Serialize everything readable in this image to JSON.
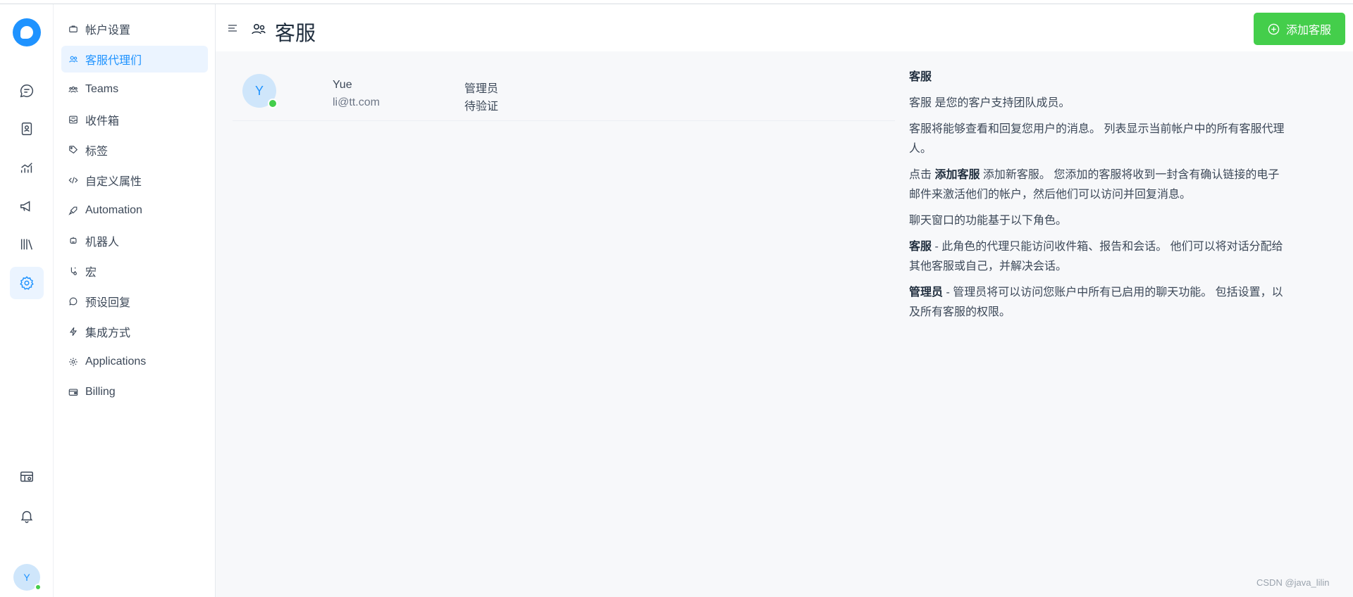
{
  "sidebar": {
    "items": [
      {
        "label": "帐户设置",
        "icon": "briefcase-icon"
      },
      {
        "label": "客服代理们",
        "icon": "people-icon",
        "active": true
      },
      {
        "label": "Teams",
        "icon": "teams-icon"
      },
      {
        "label": "收件箱",
        "icon": "inbox-icon"
      },
      {
        "label": "标签",
        "icon": "tag-icon"
      },
      {
        "label": "自定义属性",
        "icon": "code-icon"
      },
      {
        "label": "Automation",
        "icon": "rocket-icon"
      },
      {
        "label": "机器人",
        "icon": "bot-icon"
      },
      {
        "label": "宏",
        "icon": "macro-icon"
      },
      {
        "label": "预设回复",
        "icon": "chat-bubble-icon"
      },
      {
        "label": "集成方式",
        "icon": "flash-icon"
      },
      {
        "label": "Applications",
        "icon": "apps-icon"
      },
      {
        "label": "Billing",
        "icon": "wallet-icon"
      }
    ]
  },
  "rail": {
    "avatar_initial": "Y",
    "icons": [
      "conversations-icon",
      "contacts-icon",
      "reports-icon",
      "campaigns-icon",
      "library-icon",
      "settings-icon",
      "portal-icon",
      "bell-icon"
    ]
  },
  "header": {
    "title": "客服",
    "add_button_label": "添加客服"
  },
  "agents": [
    {
      "initial": "Y",
      "name": "Yue",
      "email": "li@tt.com",
      "role": "管理员",
      "status": "待验证"
    }
  ],
  "help": {
    "title": "客服",
    "p1": "客服 是您的客户支持团队成员。",
    "p2": "客服将能够查看和回复您用户的消息。 列表显示当前帐户中的所有客服代理人。",
    "p3_prefix": "点击 ",
    "p3_bold": "添加客服",
    "p3_suffix": " 添加新客服。 您添加的客服将收到一封含有确认链接的电子邮件来激活他们的帐户，然后他们可以访问并回复消息。",
    "p4": "聊天窗口的功能基于以下角色。",
    "p5_bold": "客服",
    "p5_text": " - 此角色的代理只能访问收件箱、报告和会话。 他们可以将对话分配给其他客服或自己，并解决会话。",
    "p6_bold": "管理员",
    "p6_text": " - 管理员将可以访问您账户中所有已启用的聊天功能。 包括设置，以及所有客服的权限。"
  },
  "watermark": "CSDN @java_lilin",
  "colors": {
    "accent": "#1f93ff",
    "success": "#44ce4b"
  }
}
